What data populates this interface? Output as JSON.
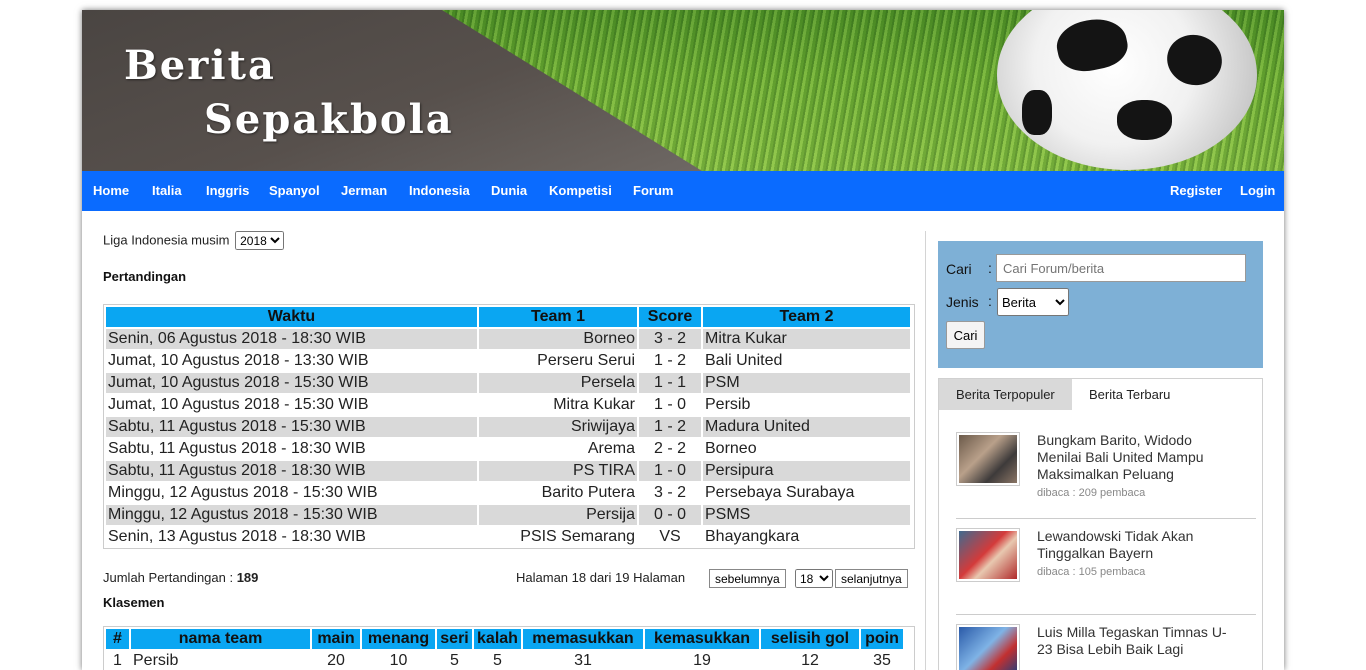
{
  "header": {
    "title_line1": "Berita",
    "title_line2": "Sepakbola"
  },
  "nav": {
    "left": [
      "Home",
      "Italia",
      "Inggris",
      "Spanyol",
      "Jerman",
      "Indonesia",
      "Dunia",
      "Kompetisi",
      "Forum"
    ],
    "right": [
      "Register",
      "Login"
    ]
  },
  "season": {
    "label": "Liga Indonesia musim",
    "selected": "2018"
  },
  "matches": {
    "title": "Pertandingan",
    "headers": [
      "Waktu",
      "Team 1",
      "Score",
      "Team 2"
    ],
    "rows": [
      [
        "Senin, 06 Agustus 2018 - 18:30 WIB",
        "Borneo",
        "3 - 2",
        "Mitra Kukar"
      ],
      [
        "Jumat, 10 Agustus 2018 - 13:30 WIB",
        "Perseru Serui",
        "1 - 2",
        "Bali United"
      ],
      [
        "Jumat, 10 Agustus 2018 - 15:30 WIB",
        "Persela",
        "1 - 1",
        "PSM"
      ],
      [
        "Jumat, 10 Agustus 2018 - 15:30 WIB",
        "Mitra Kukar",
        "1 - 0",
        "Persib"
      ],
      [
        "Sabtu, 11 Agustus 2018 - 15:30 WIB",
        "Sriwijaya",
        "1 - 2",
        "Madura United"
      ],
      [
        "Sabtu, 11 Agustus 2018 - 18:30 WIB",
        "Arema",
        "2 - 2",
        "Borneo"
      ],
      [
        "Sabtu, 11 Agustus 2018 - 18:30 WIB",
        "PS TIRA",
        "1 - 0",
        "Persipura"
      ],
      [
        "Minggu, 12 Agustus 2018 - 15:30 WIB",
        "Barito Putera",
        "3 - 2",
        "Persebaya Surabaya"
      ],
      [
        "Minggu, 12 Agustus 2018 - 15:30 WIB",
        "Persija",
        "0 - 0",
        "PSMS"
      ],
      [
        "Senin, 13 Agustus 2018 - 18:30 WIB",
        "PSIS Semarang",
        "VS",
        "Bhayangkara"
      ]
    ],
    "count_label": "Jumlah Pertandingan : ",
    "count_value": "189",
    "page_text": "Halaman 18 dari 19 Halaman",
    "prev_label": "sebelumnya",
    "page_selected": "18",
    "next_label": "selanjutnya"
  },
  "standings": {
    "title": "Klasemen",
    "headers": [
      "#",
      "nama team",
      "main",
      "menang",
      "seri",
      "kalah",
      "memasukkan",
      "kemasukkan",
      "selisih gol",
      "poin"
    ],
    "rows": [
      [
        "1",
        "Persib",
        "20",
        "10",
        "5",
        "5",
        "31",
        "19",
        "12",
        "35"
      ]
    ]
  },
  "search": {
    "cari_label": "Cari",
    "placeholder": "Cari Forum/berita",
    "jenis_label": "Jenis",
    "jenis_selected": "Berita",
    "button": "Cari"
  },
  "news": {
    "tab_active": "Berita Terpopuler",
    "tab_other": "Berita Terbaru",
    "items": [
      {
        "title": "Bungkam Barito, Widodo Menilai Bali United Mampu Maksimalkan Peluang",
        "meta": "dibaca : 209 pembaca"
      },
      {
        "title": "Lewandowski Tidak Akan Tinggalkan Bayern",
        "meta": "dibaca : 105 pembaca"
      },
      {
        "title": "Luis Milla Tegaskan Timnas U-23 Bisa Lebih Baik Lagi",
        "meta": ""
      }
    ]
  },
  "colors": {
    "nav": "#0a6bff",
    "table_header": "#0aa6f2",
    "row_alt": "#d9d9d9",
    "search_bg": "#7eb0d6"
  }
}
